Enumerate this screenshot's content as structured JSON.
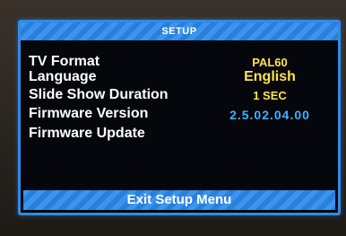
{
  "menu": {
    "title": "SETUP",
    "items": [
      {
        "label": "TV Format",
        "value": "PAL60"
      },
      {
        "label": "Language",
        "value": "English"
      },
      {
        "label": "Slide Show Duration",
        "value": "1 SEC"
      },
      {
        "label": "Firmware Version",
        "value": "2.5.02.04.00"
      },
      {
        "label": "Firmware Update",
        "value": ""
      }
    ],
    "exit_label": "Exit Setup Menu"
  },
  "colors": {
    "accent_blue": "#2f8be8",
    "value_yellow": "#ffe24a",
    "value_cyan": "#3fb0ff",
    "panel_background": "#05070c"
  }
}
